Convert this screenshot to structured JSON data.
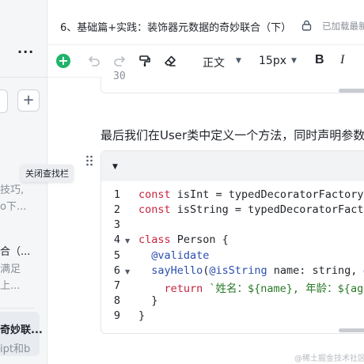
{
  "titlebar": {
    "doc_title": "6、基础篇+实践：装饰器元数据的奇妙联合（下）",
    "save_status": "已加载最新"
  },
  "toolbar": {
    "insert_icon": "plus-icon",
    "paragraph_style": "正文",
    "font_size": "15px",
    "bold_label": "B",
    "italic_label": "I"
  },
  "sidebar": {
    "more_label": "···",
    "add_label": "+",
    "snippets": [
      "技巧,",
      "o下...",
      "合（...",
      "满足",
      "上...",
      "奇妙联...",
      "ipt和b"
    ]
  },
  "tooltip": "关闭查找栏",
  "editor": {
    "prev_block_line": "30",
    "paragraph": "最后我们在User类中定义一个方法，同时声明参数"
  },
  "code_block": {
    "line_numbers": [
      "1",
      "2",
      "3",
      "4",
      "5",
      "6",
      "7",
      "8",
      "9"
    ]
  },
  "watermark": "@稀土掘金技术社区",
  "colors": {
    "accent_green": "#1fb36a",
    "keyword": "#c8243e",
    "decorator": "#2c4fae",
    "string": "#2b7a28"
  }
}
